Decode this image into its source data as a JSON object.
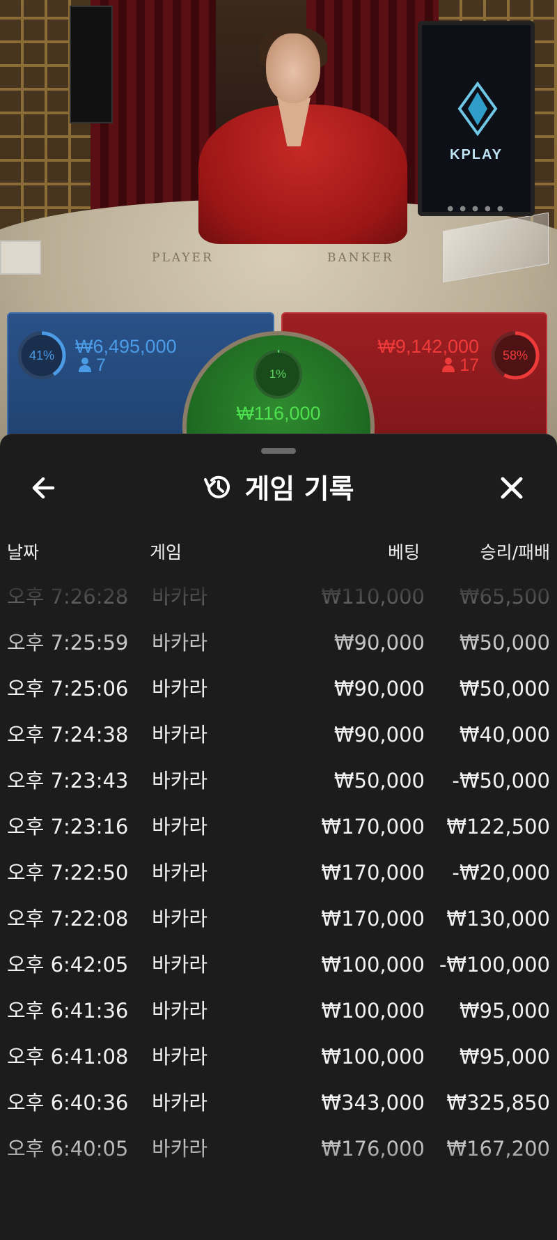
{
  "video": {
    "monitor_brand": "KPLAY",
    "table_labels": {
      "player": "PLAYER",
      "banker": "BANKER"
    }
  },
  "bets": {
    "player": {
      "percent": "41%",
      "percent_value": 41,
      "amount": "₩6,495,000",
      "players": "7",
      "color": "#4c9be6"
    },
    "tie": {
      "percent": "1%",
      "percent_value": 1,
      "amount": "₩116,000",
      "color": "#4fe04f"
    },
    "banker": {
      "percent": "58%",
      "percent_value": 58,
      "amount": "₩9,142,000",
      "players": "17",
      "color": "#ef3a3a"
    }
  },
  "sheet": {
    "title": "게임 기록",
    "back_icon": "arrow-left-icon",
    "history_icon": "history-icon",
    "close_icon": "close-icon",
    "columns": {
      "date": "날짜",
      "game": "게임",
      "bet": "베팅",
      "win_loss": "승리/패배"
    },
    "rows": [
      {
        "date": "오후 7:26:28",
        "game": "바카라",
        "bet": "₩110,000",
        "win_loss": "₩65,500"
      },
      {
        "date": "오후 7:25:59",
        "game": "바카라",
        "bet": "₩90,000",
        "win_loss": "₩50,000"
      },
      {
        "date": "오후 7:25:06",
        "game": "바카라",
        "bet": "₩90,000",
        "win_loss": "₩50,000"
      },
      {
        "date": "오후 7:24:38",
        "game": "바카라",
        "bet": "₩90,000",
        "win_loss": "₩40,000"
      },
      {
        "date": "오후 7:23:43",
        "game": "바카라",
        "bet": "₩50,000",
        "win_loss": "-₩50,000"
      },
      {
        "date": "오후 7:23:16",
        "game": "바카라",
        "bet": "₩170,000",
        "win_loss": "₩122,500"
      },
      {
        "date": "오후 7:22:50",
        "game": "바카라",
        "bet": "₩170,000",
        "win_loss": "-₩20,000"
      },
      {
        "date": "오후 7:22:08",
        "game": "바카라",
        "bet": "₩170,000",
        "win_loss": "₩130,000"
      },
      {
        "date": "오후 6:42:05",
        "game": "바카라",
        "bet": "₩100,000",
        "win_loss": "-₩100,000"
      },
      {
        "date": "오후 6:41:36",
        "game": "바카라",
        "bet": "₩100,000",
        "win_loss": "₩95,000"
      },
      {
        "date": "오후 6:41:08",
        "game": "바카라",
        "bet": "₩100,000",
        "win_loss": "₩95,000"
      },
      {
        "date": "오후 6:40:36",
        "game": "바카라",
        "bet": "₩343,000",
        "win_loss": "₩325,850"
      },
      {
        "date": "오후 6:40:05",
        "game": "바카라",
        "bet": "₩176,000",
        "win_loss": "₩167,200"
      }
    ]
  }
}
